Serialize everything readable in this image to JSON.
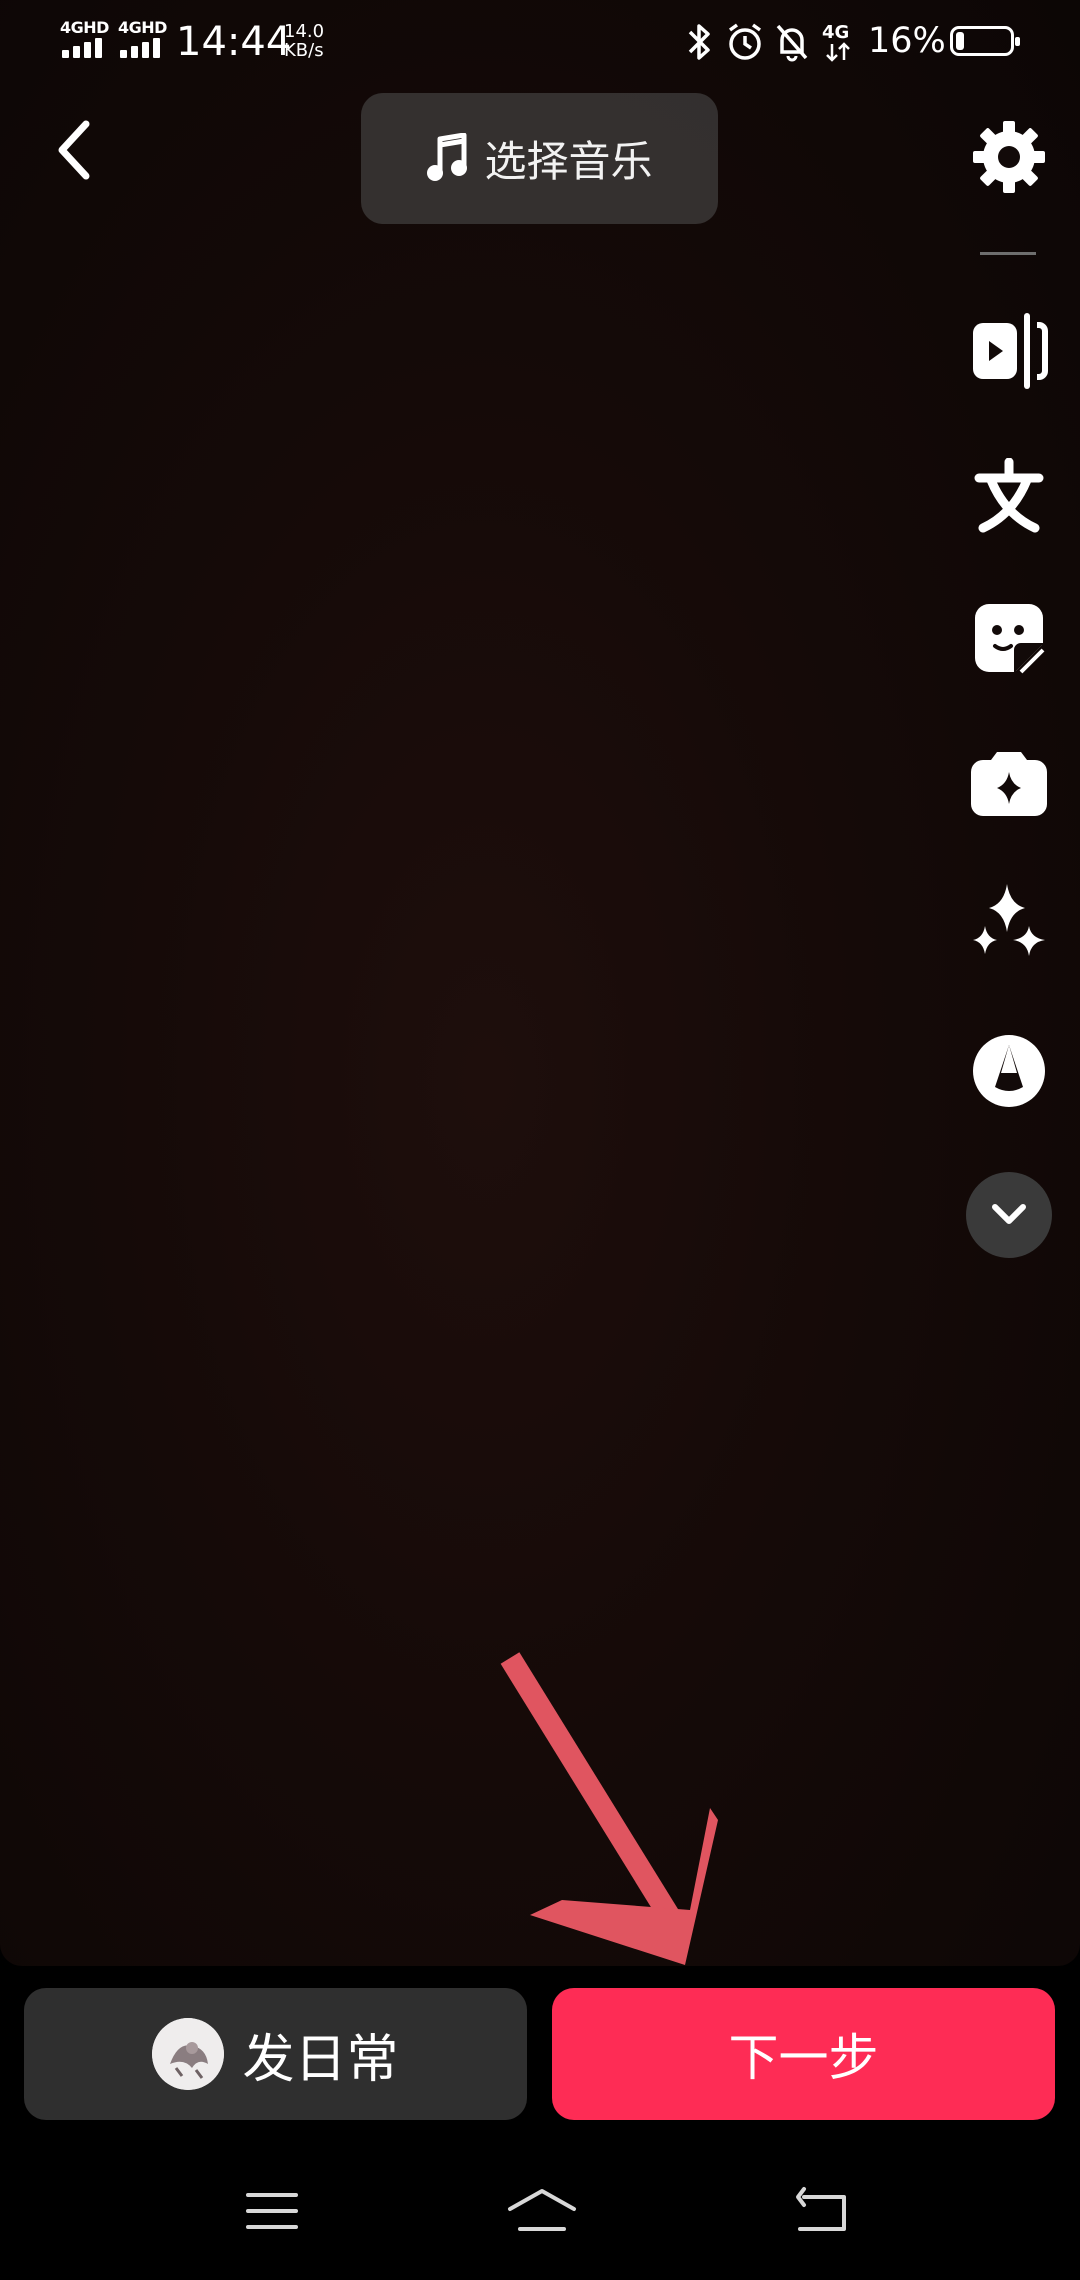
{
  "status_bar": {
    "sim1": "4GHD",
    "sim2": "4GHD",
    "time": "14:44",
    "net_speed_value": "14.0",
    "net_speed_unit": "KB/s",
    "network_type": "4G",
    "battery_percent": "16%",
    "battery_level": 0.16,
    "icons": [
      "bluetooth-icon",
      "alarm-icon",
      "mute-bell-icon",
      "4g-data-icon"
    ]
  },
  "top_bar": {
    "back_icon": "chevron-left-icon",
    "music_button_label": "选择音乐",
    "settings_icon": "gear-icon"
  },
  "side_tools": [
    "split-clip-icon",
    "text-icon",
    "sticker-icon",
    "effects-icon",
    "sparkle-icon",
    "filter-icon",
    "chevron-down-icon"
  ],
  "bottom": {
    "daily_button_label": "发日常",
    "next_button_label": "下一步",
    "next_button_color": "#fe2c55",
    "annotation_arrow_color": "#e05560"
  },
  "nav_bar": {
    "icons": [
      "menu-icon",
      "home-icon",
      "back-icon"
    ]
  }
}
